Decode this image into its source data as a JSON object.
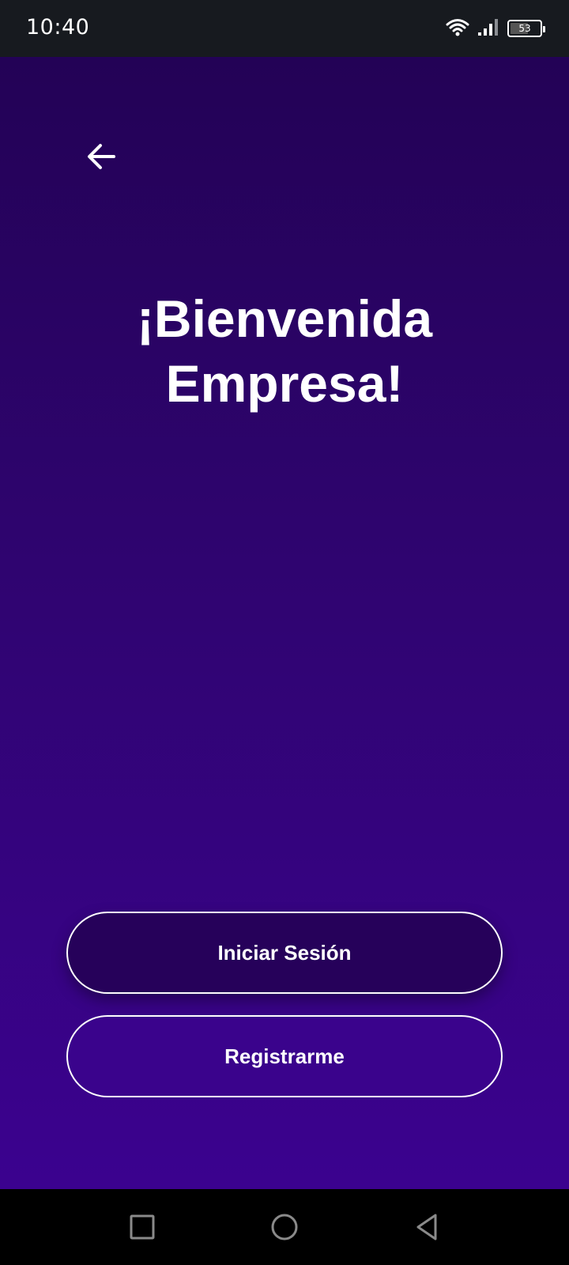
{
  "status_bar": {
    "time": "10:40",
    "battery": "53",
    "icons": [
      "wifi-icon",
      "signal-icon",
      "battery-icon"
    ]
  },
  "nav": {
    "back_icon": "arrow-left-icon"
  },
  "welcome": {
    "line1": "¡Bienvenida",
    "line2": "Empresa!"
  },
  "actions": {
    "login_label": "Iniciar Sesión",
    "register_label": "Registrarme"
  },
  "system_nav": {
    "icons": [
      "recents-square-icon",
      "home-circle-icon",
      "back-triangle-icon"
    ]
  },
  "colors": {
    "gradient_top": "#230256",
    "gradient_bottom": "#3b028f",
    "login_button_bg": "#26015a",
    "text": "#ffffff"
  }
}
